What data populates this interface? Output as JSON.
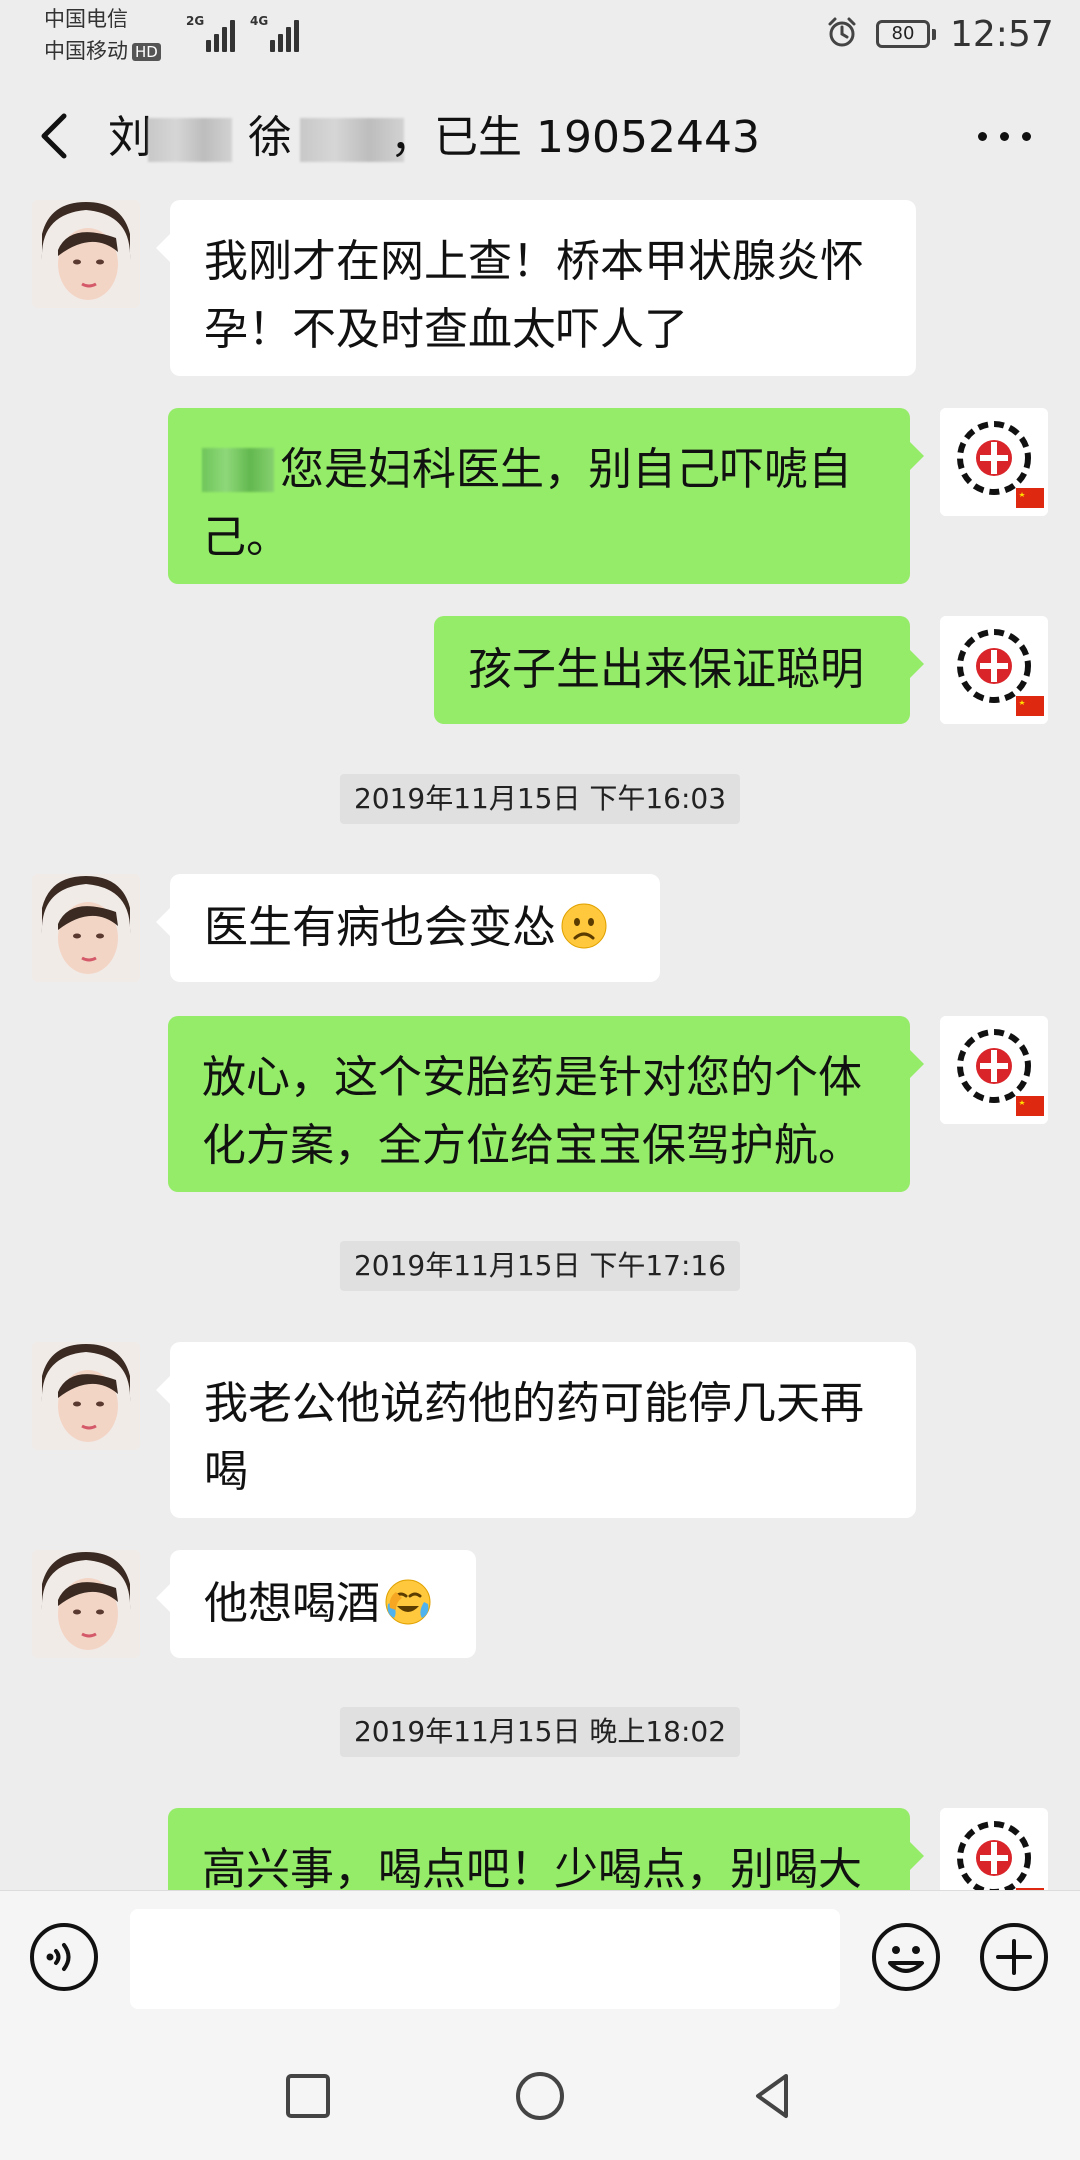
{
  "status_bar": {
    "carrier_1": "中国电信",
    "carrier_2": "中国移动",
    "hd_badge": "HD",
    "signal_1_label": "2G",
    "signal_2_label": "4G",
    "battery_level": "80",
    "time": "12:57"
  },
  "header": {
    "name_1_start": "刘",
    "name_2_start": "徐",
    "title_rest": "，已生 19052443"
  },
  "messages": [
    {
      "side": "in",
      "text_lines": [
        "我刚才在网上查！桥本甲状腺炎怀",
        "孕！不及时查血太吓人了"
      ]
    },
    {
      "side": "out",
      "text_lines": [
        "您是妇科医生，别自己吓唬自",
        "己。"
      ]
    },
    {
      "side": "out",
      "text_lines": [
        "孩子生出来保证聪明"
      ]
    },
    {
      "timestamp": "2019年11月15日 下午16:03"
    },
    {
      "side": "in",
      "text_lines": [
        "医生有病也会变怂"
      ],
      "emoji": "frowning-face"
    },
    {
      "side": "out",
      "text_lines": [
        "放心，这个安胎药是针对您的个体",
        "化方案，全方位给宝宝保驾护航。"
      ]
    },
    {
      "timestamp": "2019年11月15日 下午17:16"
    },
    {
      "side": "in",
      "text_lines": [
        "我老公他说药他的药可能停几天再",
        "喝"
      ]
    },
    {
      "side": "in",
      "text_lines": [
        "他想喝酒"
      ],
      "emoji": "face-with-tears"
    },
    {
      "timestamp": "2019年11月15日 晚上18:02"
    },
    {
      "side": "out",
      "text_lines": [
        "高兴事，喝点吧！少喝点，别喝大"
      ]
    }
  ],
  "input": {
    "placeholder": ""
  },
  "colors": {
    "background": "#ededed",
    "incoming_bubble": "#ffffff",
    "outgoing_bubble": "#95ec69"
  },
  "icons": [
    "back-arrow-icon",
    "more-options-icon",
    "voice-icon",
    "emoji-icon",
    "plus-icon",
    "nav-square-icon",
    "nav-circle-icon",
    "nav-back-icon",
    "alarm-icon"
  ]
}
